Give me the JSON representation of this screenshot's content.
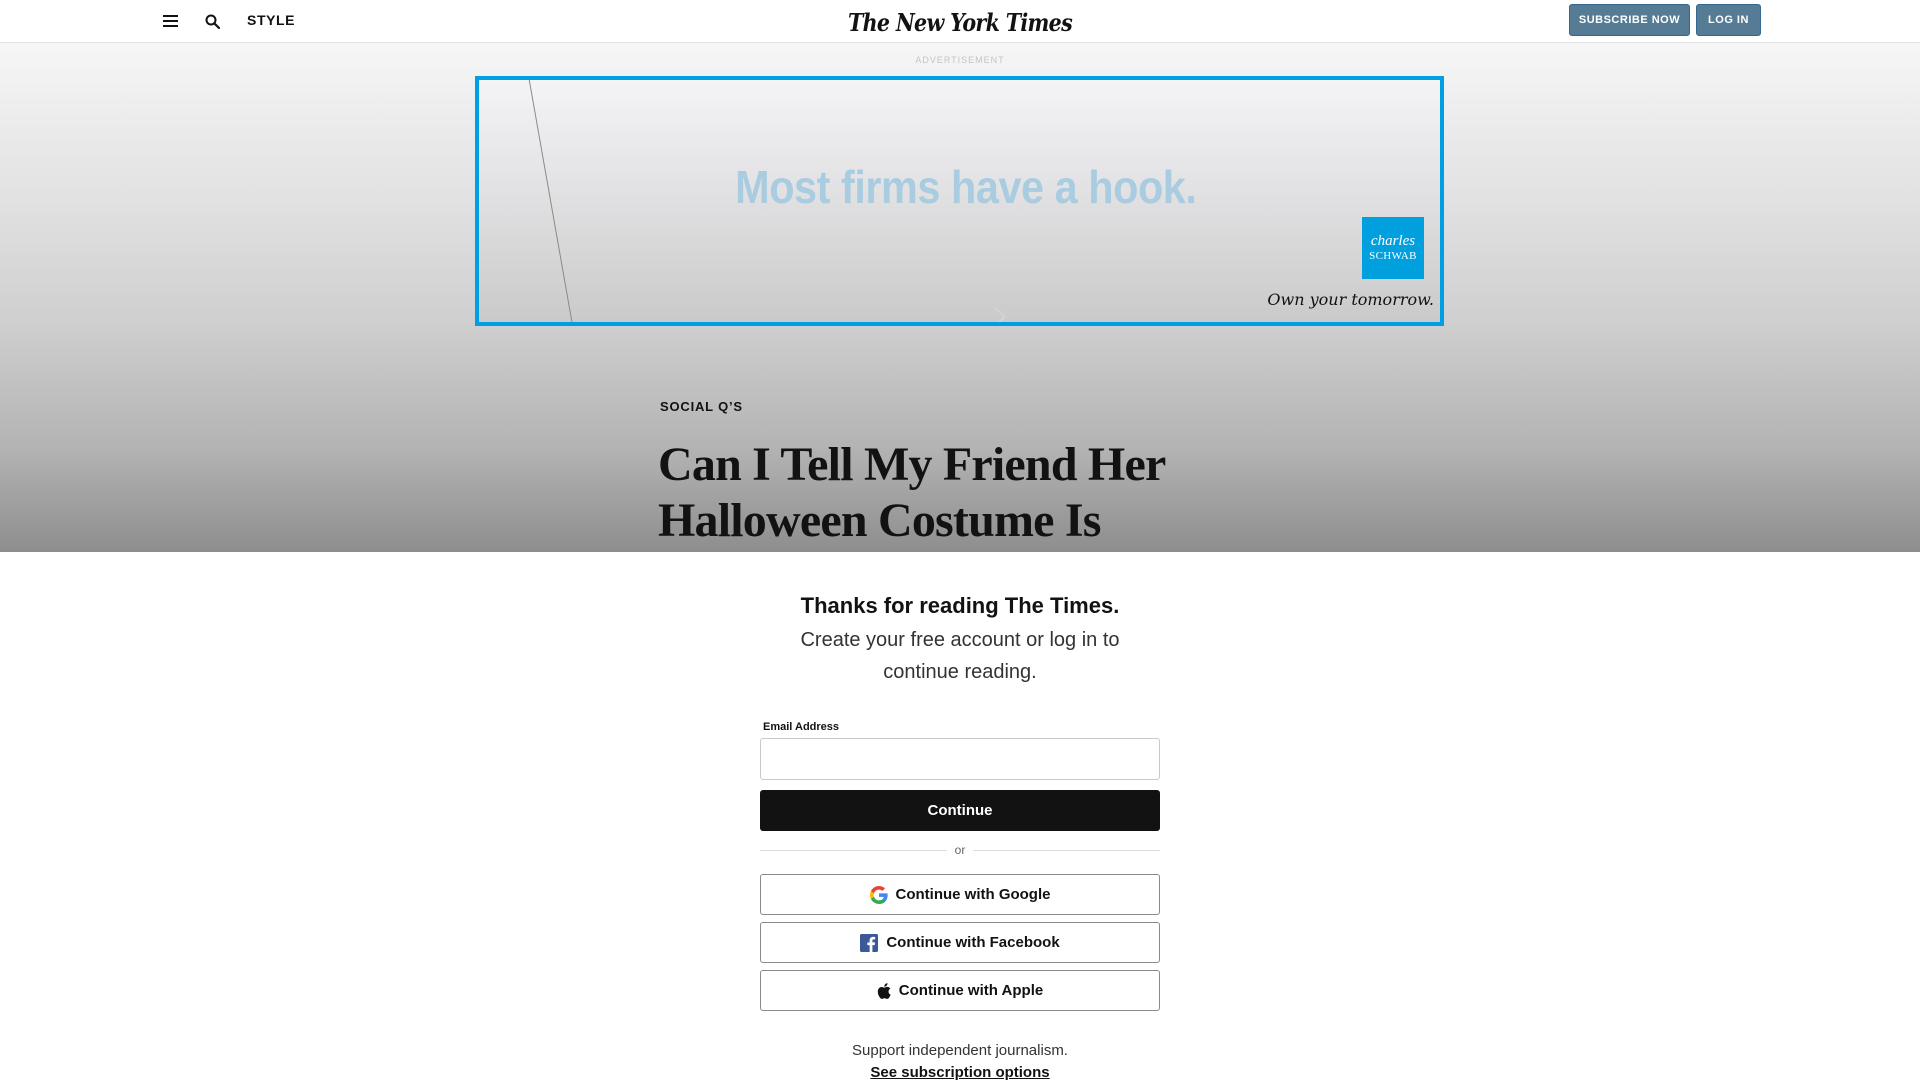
{
  "header": {
    "menu_icon": "hamburger-menu-icon",
    "search_icon": "search-icon",
    "section_label": "STYLE",
    "logo_text": "The New York Times",
    "subscribe_label": "SUBSCRIBE NOW",
    "login_label": "LOG IN",
    "button_color": "#567b95"
  },
  "ad": {
    "label": "ADVERTISEMENT",
    "headline": "Most firms have a hook.",
    "brand_line1": "charles",
    "brand_line2": "SCHWAB",
    "tagline": "Own your tomorrow.",
    "border_color": "#009fe3"
  },
  "article": {
    "kicker": "SOCIAL Q’S",
    "headline": "Can I Tell My Friend Her Halloween Costume Is"
  },
  "login": {
    "title": "Thanks for reading The Times.",
    "subtitle": "Create your free account or log in to continue reading.",
    "email_label": "Email Address",
    "email_value": "",
    "continue_label": "Continue",
    "divider_label": "or",
    "google_label": "Continue with Google",
    "facebook_label": "Continue with Facebook",
    "apple_label": "Continue with Apple",
    "support_text": "Support independent journalism.",
    "subscription_link": "See subscription options"
  }
}
